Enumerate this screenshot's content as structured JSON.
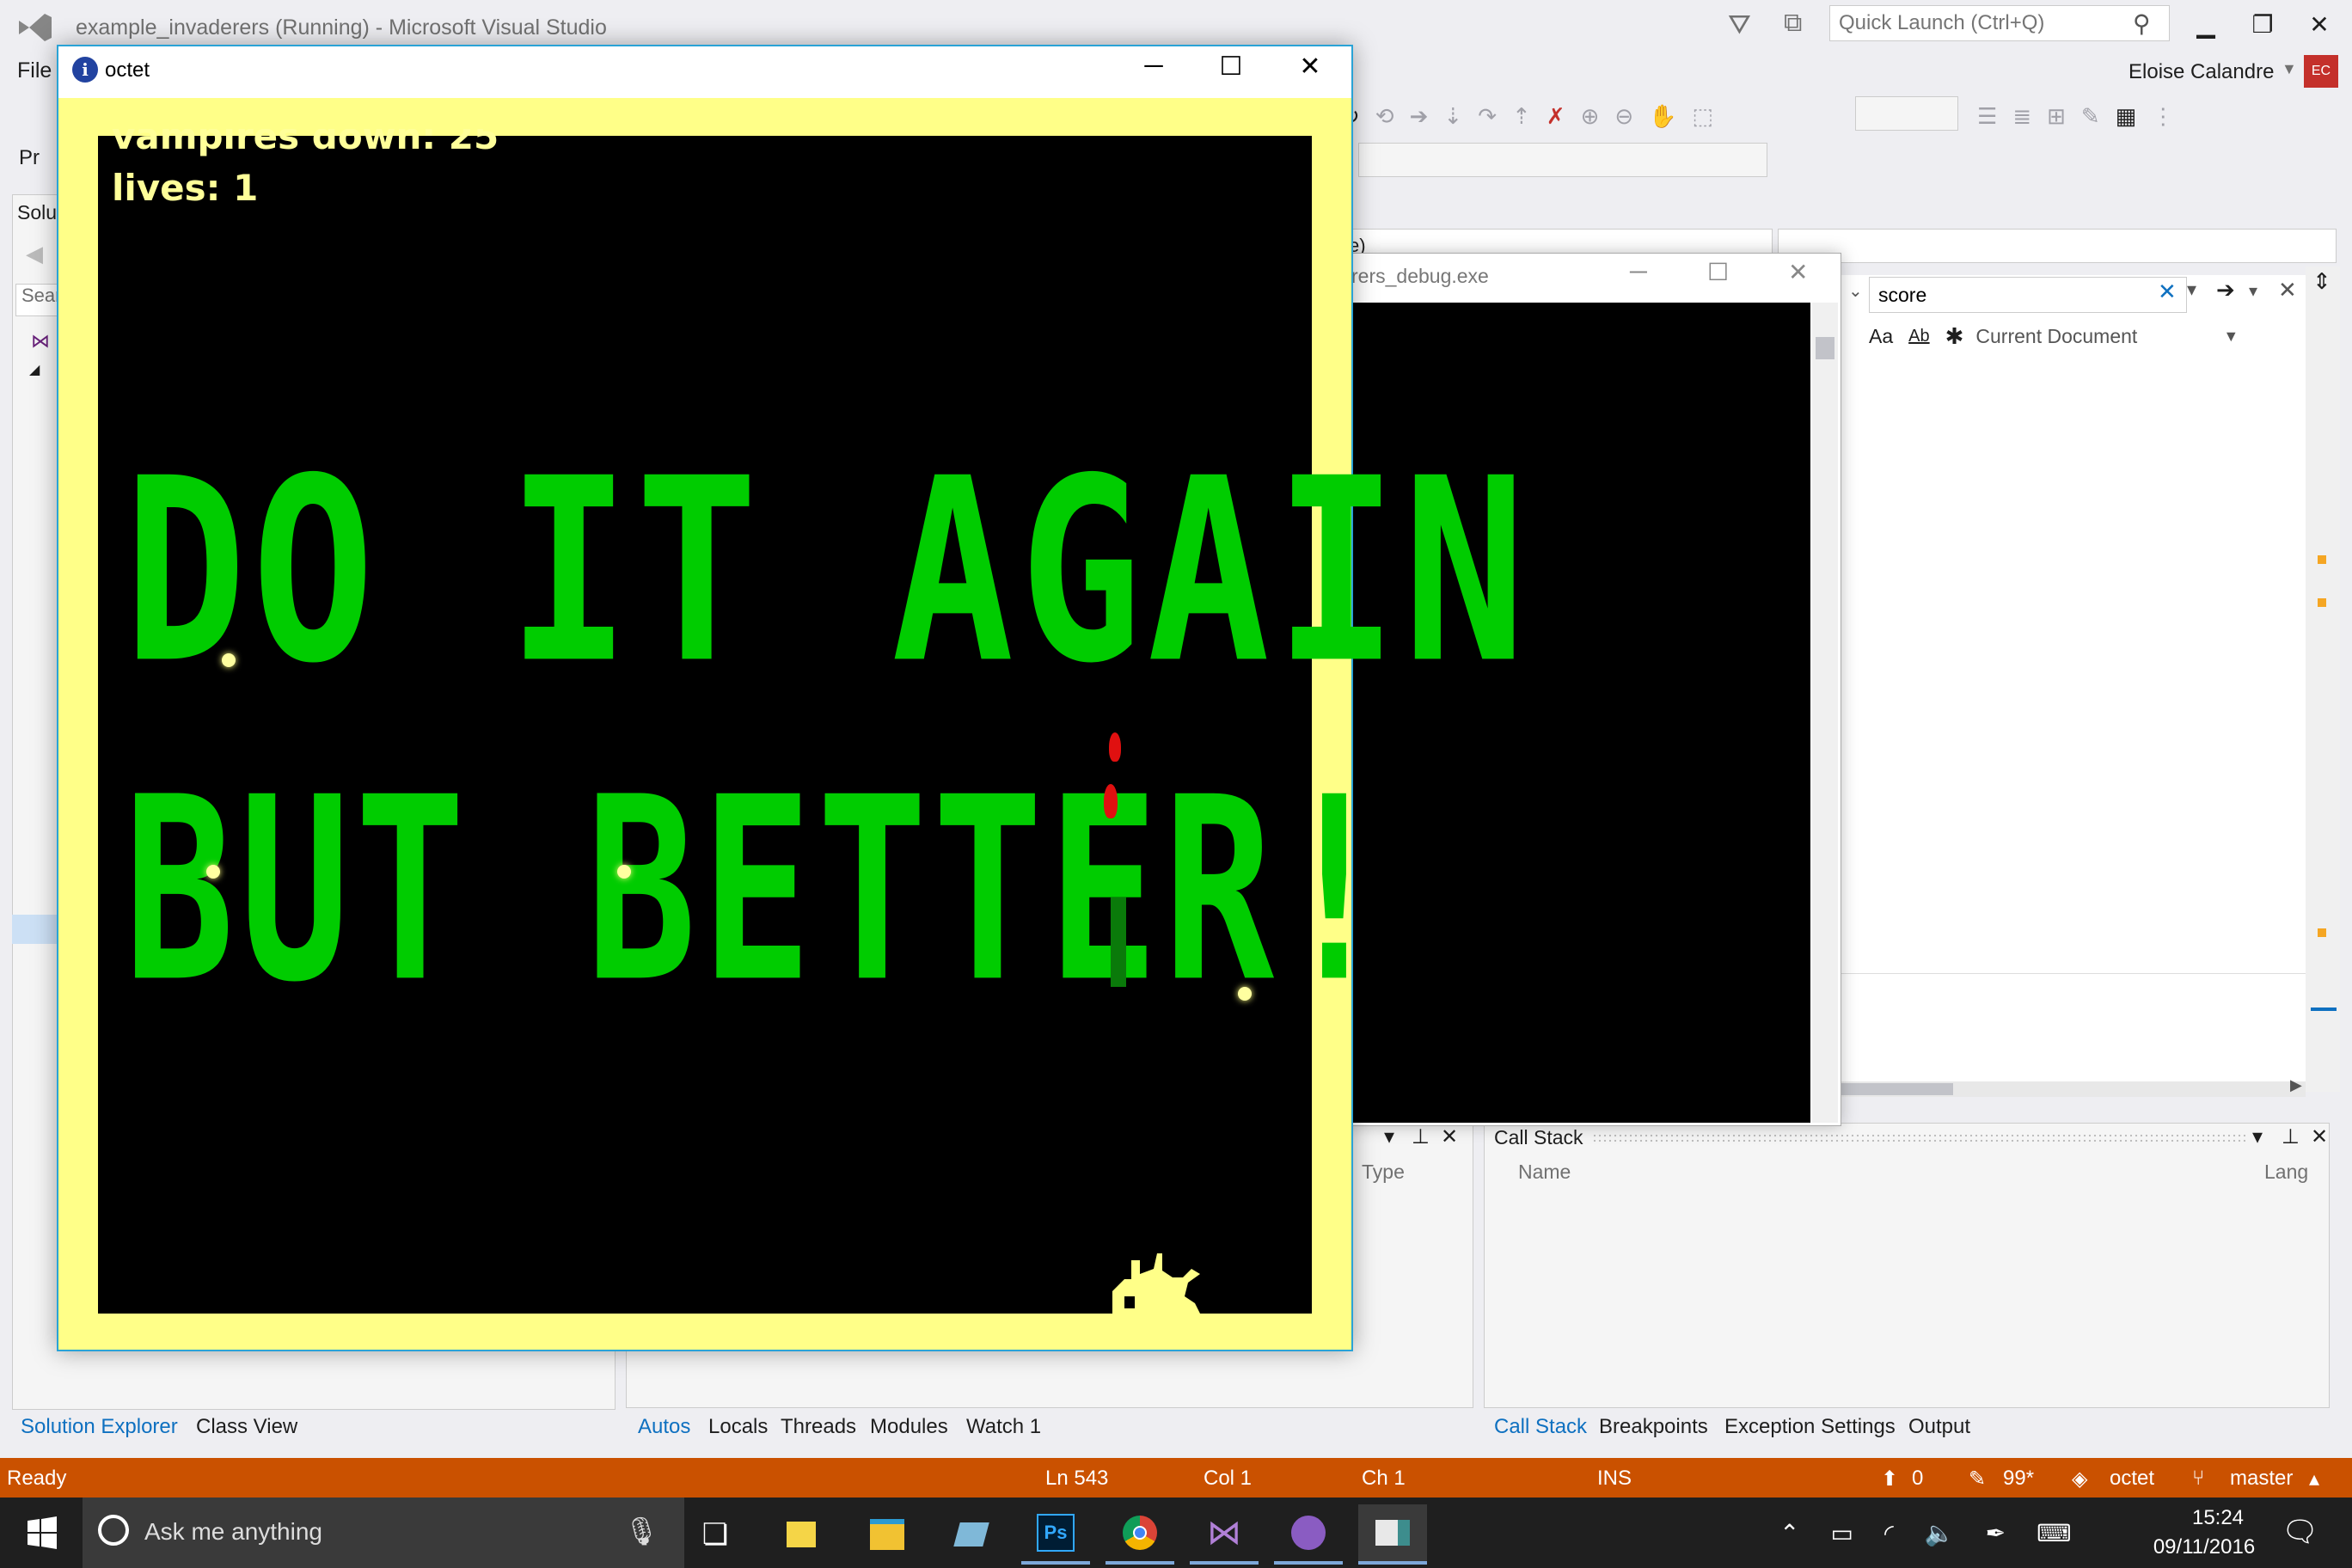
{
  "vs": {
    "title": "example_invaderers (Running) - Microsoft Visual Studio",
    "quick_launch_placeholder": "Quick Launch (Ctrl+Q)",
    "user_name": "Eloise Calandre",
    "user_initials": "EC",
    "menu_file": "File",
    "solution_header": "Solu",
    "solution_search": "Sear",
    "toolbar_frag": "Pr",
    "combo_frag": "e)"
  },
  "bottom_tabs_left": [
    "Solution Explorer",
    "Class View"
  ],
  "bottom_tabs_mid": [
    "Autos",
    "Locals",
    "Threads",
    "Modules",
    "Watch 1"
  ],
  "bottom_tabs_right": [
    "Call Stack",
    "Breakpoints",
    "Exception Settings",
    "Output"
  ],
  "autos": {
    "type_header": "Type"
  },
  "callstack": {
    "title": "Call Stack",
    "name_header": "Name",
    "lang_header": "Lang"
  },
  "find": {
    "value": "score",
    "scope": "Current Document",
    "opt_case": "Aa",
    "opt_word": "Ab"
  },
  "console": {
    "title": "rers_debug.exe"
  },
  "octet": {
    "title": "octet",
    "hud_vampires": "vampires down: 25",
    "hud_lives": "lives: 1",
    "banner_line1": "DO IT AGAIN",
    "banner_line2": "BUT BETTER!"
  },
  "status": {
    "ready": "Ready",
    "ln": "Ln 543",
    "col": "Col 1",
    "ch": "Ch 1",
    "ins": "INS",
    "up_count": "0",
    "pencil_count": "99*",
    "repo": "octet",
    "branch": "master"
  },
  "taskbar": {
    "search_placeholder": "Ask me anything",
    "time": "15:24",
    "date": "09/11/2016",
    "notifications": "1"
  },
  "colors": {
    "status_bar": "#ca5100",
    "octet_border": "#ffff88",
    "banner_green": "#00cc00",
    "hud_yellow": "#ffff99",
    "accent_blue": "#0e70c0"
  }
}
